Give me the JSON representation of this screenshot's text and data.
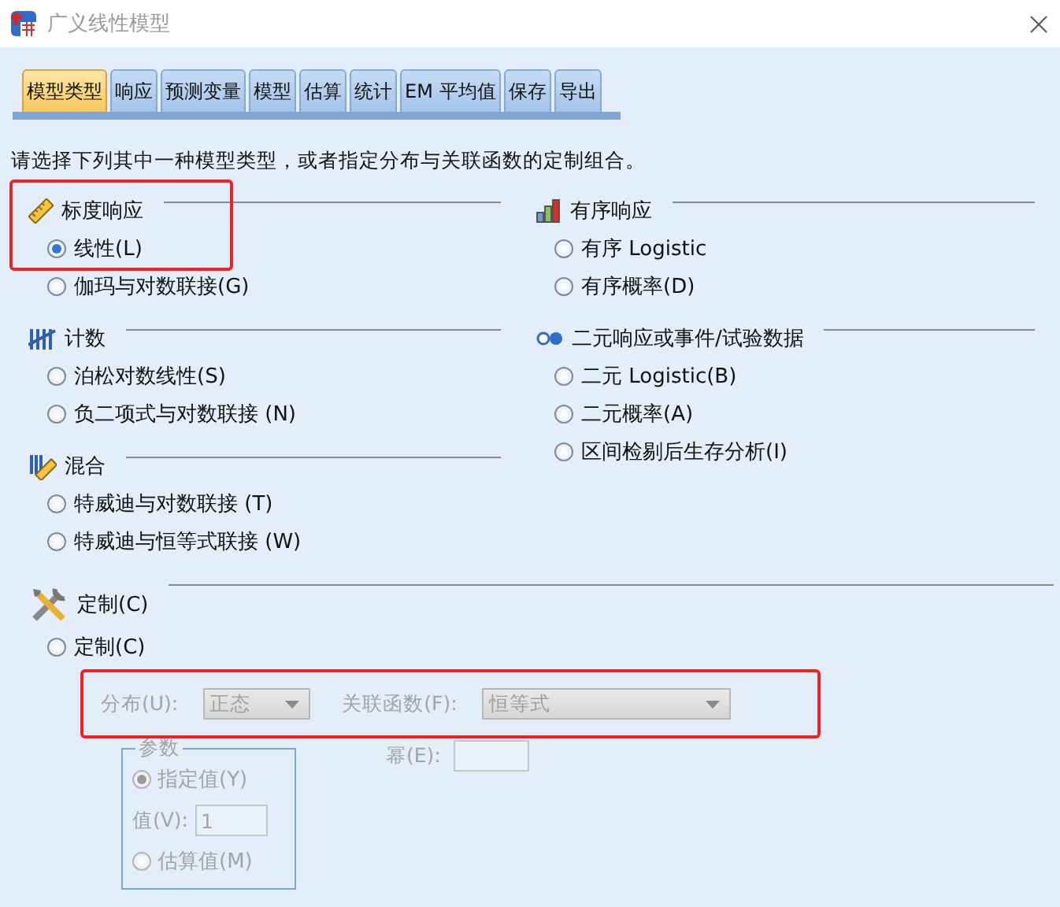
{
  "window": {
    "title": "广义线性模型"
  },
  "tabs": [
    {
      "label": "模型类型",
      "selected": true
    },
    {
      "label": "响应",
      "selected": false
    },
    {
      "label": "预测变量",
      "selected": false
    },
    {
      "label": "模型",
      "selected": false
    },
    {
      "label": "估算",
      "selected": false
    },
    {
      "label": "统计",
      "selected": false
    },
    {
      "label": "EM 平均值",
      "selected": false
    },
    {
      "label": "保存",
      "selected": false
    },
    {
      "label": "导出",
      "selected": false
    }
  ],
  "instruction": "请选择下列其中一种模型类型，或者指定分布与关联函数的定制组合。",
  "left_groups": [
    {
      "kind": "scale",
      "heading": "标度响应",
      "highlighted": true,
      "options": [
        {
          "label": "线性(L)",
          "selected": true
        },
        {
          "label": "伽玛与对数联接(G)",
          "selected": false
        }
      ]
    },
    {
      "kind": "count",
      "heading": "计数",
      "options": [
        {
          "label": "泊松对数线性(S)",
          "selected": false
        },
        {
          "label": "负二项式与对数联接 (N)",
          "selected": false
        }
      ]
    },
    {
      "kind": "mixed",
      "heading": "混合",
      "options": [
        {
          "label": "特威迪与对数联接 (T)",
          "selected": false
        },
        {
          "label": "特威迪与恒等式联接 (W)",
          "selected": false
        }
      ]
    }
  ],
  "right_groups": [
    {
      "kind": "ordinal",
      "heading": "有序响应",
      "options": [
        {
          "label": "有序 Logistic",
          "selected": false
        },
        {
          "label": "有序概率(D)",
          "selected": false
        }
      ]
    },
    {
      "kind": "binary",
      "heading": "二元响应或事件/试验数据",
      "options": [
        {
          "label": "二元 Logistic(B)",
          "selected": false
        },
        {
          "label": "二元概率(A)",
          "selected": false
        },
        {
          "label": "区间检剔后生存分析(I)",
          "selected": false
        }
      ]
    }
  ],
  "custom": {
    "heading": "定制(C)",
    "option": {
      "label": "定制(C)",
      "selected": false
    },
    "disabled": true,
    "highlighted": true,
    "distribution": {
      "label": "分布(U):",
      "value": "正态"
    },
    "link_function": {
      "label": "关联函数(F):",
      "value": "恒等式"
    },
    "parameter": {
      "title": "参数",
      "options": [
        {
          "label": "指定值(Y)",
          "selected": true
        },
        {
          "label": "估算值(M)",
          "selected": false
        }
      ],
      "value_label": "值(V):",
      "value": "1"
    },
    "power": {
      "label": "幂(E):"
    }
  }
}
